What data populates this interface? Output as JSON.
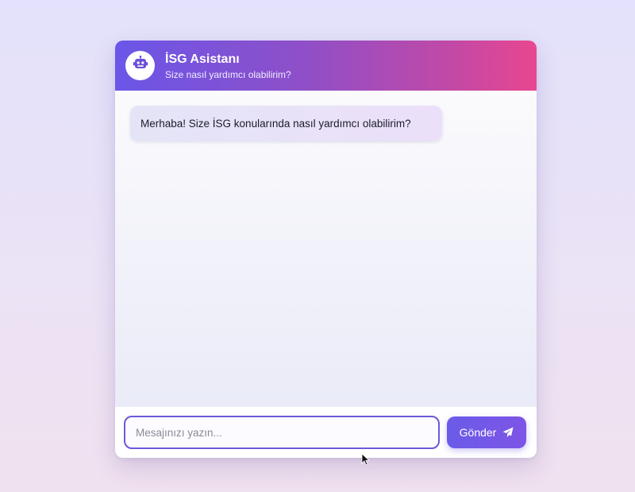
{
  "header": {
    "title": "İSG Asistanı",
    "subtitle": "Size nasıl yardımcı olabilirim?",
    "avatar_icon": "robot-icon"
  },
  "messages": [
    {
      "sender": "bot",
      "text": "Merhaba! Size İSG konularında nasıl yardımcı olabilirim?"
    }
  ],
  "composer": {
    "placeholder": "Mesajınızı yazın...",
    "value": "",
    "send_label": "Gönder",
    "send_icon": "paper-plane-icon"
  },
  "colors": {
    "header_gradient_start": "#6a56e8",
    "header_gradient_end": "#e94690",
    "accent": "#6a5ce8",
    "input_border": "#6a5ad8",
    "bubble_bg": "#e7e3f8"
  }
}
